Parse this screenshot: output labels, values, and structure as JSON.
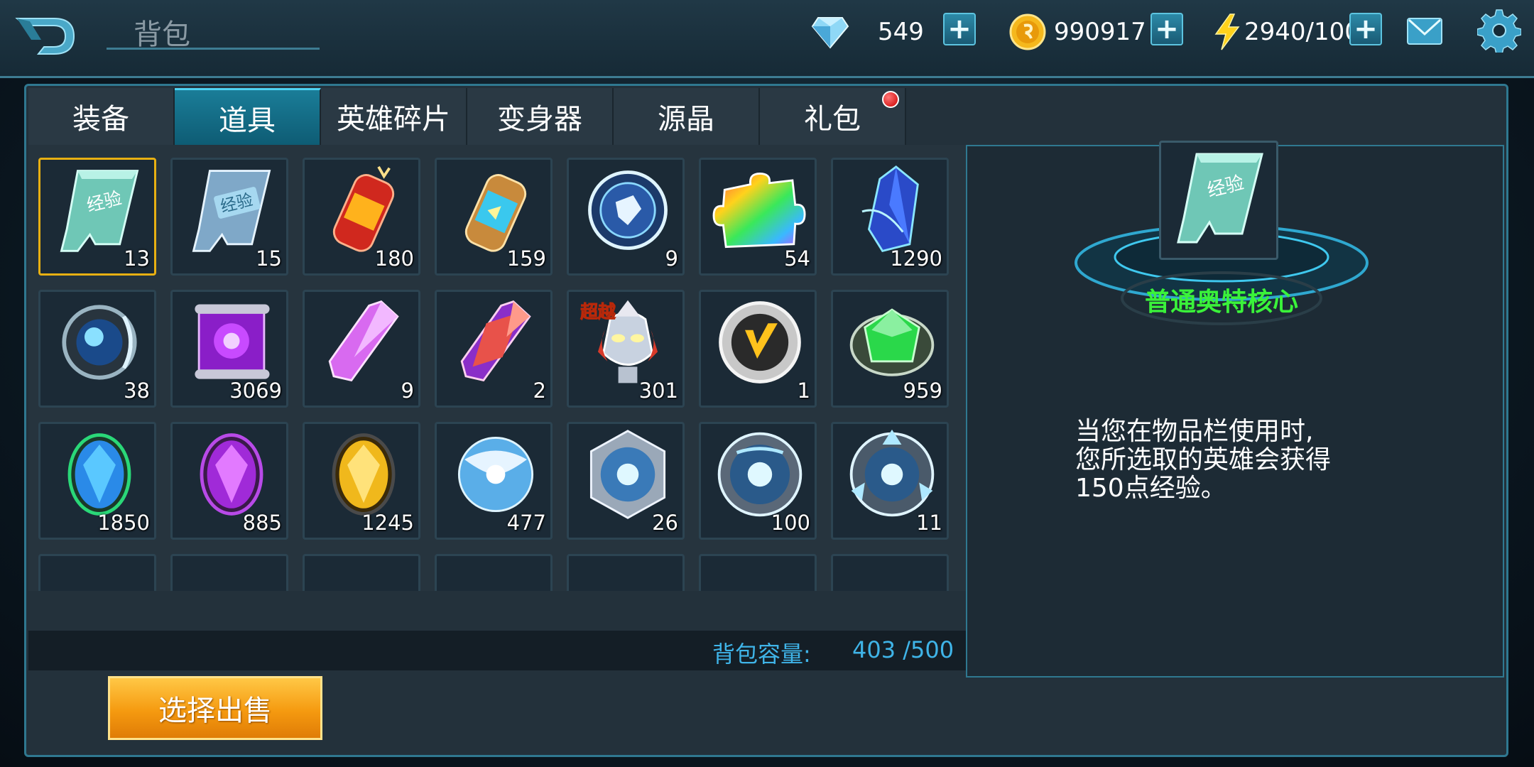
{
  "header": {
    "title": "背包",
    "resources": [
      {
        "name": "diamond-icon",
        "value": "549"
      },
      {
        "name": "gold-coin-icon",
        "value": "990917"
      },
      {
        "name": "energy-icon",
        "value": "2940/100"
      }
    ],
    "plus_label": "+"
  },
  "tabs": [
    {
      "label": "装备",
      "active": false,
      "badge": false
    },
    {
      "label": "道具",
      "active": true,
      "badge": false
    },
    {
      "label": "英雄碎片",
      "active": false,
      "badge": false
    },
    {
      "label": "变身器",
      "active": false,
      "badge": false
    },
    {
      "label": "源晶",
      "active": false,
      "badge": false
    },
    {
      "label": "礼包",
      "active": false,
      "badge": true
    }
  ],
  "items": [
    {
      "icon": "exp-card-green-icon",
      "count": "13",
      "selected": true
    },
    {
      "icon": "exp-card-blue-icon",
      "count": "15"
    },
    {
      "icon": "red-canister-icon",
      "count": "180"
    },
    {
      "icon": "blue-canister-icon",
      "count": "159"
    },
    {
      "icon": "blue-emblem-orb-icon",
      "count": "9"
    },
    {
      "icon": "rainbow-puzzle-piece-icon",
      "count": "54"
    },
    {
      "icon": "blue-crystal-shard-icon",
      "count": "1290"
    },
    {
      "icon": "blue-core-orb-icon",
      "count": "38"
    },
    {
      "icon": "purple-scroll-icon",
      "count": "3069"
    },
    {
      "icon": "pink-crystal-icon",
      "count": "9"
    },
    {
      "icon": "red-crystal-icon",
      "count": "2"
    },
    {
      "icon": "ultraman-head-icon",
      "count": "301",
      "tag": "超越"
    },
    {
      "icon": "gold-v-medal-icon",
      "count": "1"
    },
    {
      "icon": "green-gem-ring-icon",
      "count": "959"
    },
    {
      "icon": "blue-oval-gem-icon",
      "count": "1850"
    },
    {
      "icon": "purple-oval-gem-icon",
      "count": "885"
    },
    {
      "icon": "yellow-oval-gem-icon",
      "count": "1245"
    },
    {
      "icon": "blue-energy-sphere-icon",
      "count": "477"
    },
    {
      "icon": "blue-energy-core-silver-icon",
      "count": "26"
    },
    {
      "icon": "blue-energy-core-ring-icon",
      "count": "100"
    },
    {
      "icon": "blue-energy-core-crown-icon",
      "count": "11"
    },
    {
      "icon": "silver-crown-icon",
      "count": ""
    },
    {
      "icon": "green-item-icon",
      "count": ""
    },
    {
      "icon": "blue-item-icon",
      "count": ""
    },
    {
      "icon": "pink-item-icon",
      "count": ""
    },
    {
      "icon": "blue-ring-item-icon",
      "count": ""
    },
    {
      "icon": "red-gold-item-icon",
      "count": ""
    },
    {
      "icon": "green-small-item-icon",
      "count": ""
    }
  ],
  "capacity": {
    "label": "背包容量:",
    "value": "403  /500"
  },
  "sell_button": "选择出售",
  "detail": {
    "name": "普通奥特核心",
    "description": "当您在物品栏使用时，您所选取的英雄会获得150点经验。",
    "desc_lines": [
      "当您在物品栏使用时,",
      "您所选取的英雄会获得",
      "150点经验。"
    ]
  },
  "colors": {
    "accent": "#2f7890",
    "active_tab": "#0e5c74",
    "selected_border": "#e8b012",
    "detail_name": "#3af23a",
    "capacity_text": "#3fb4e8",
    "sell_button": "#f59a10"
  }
}
